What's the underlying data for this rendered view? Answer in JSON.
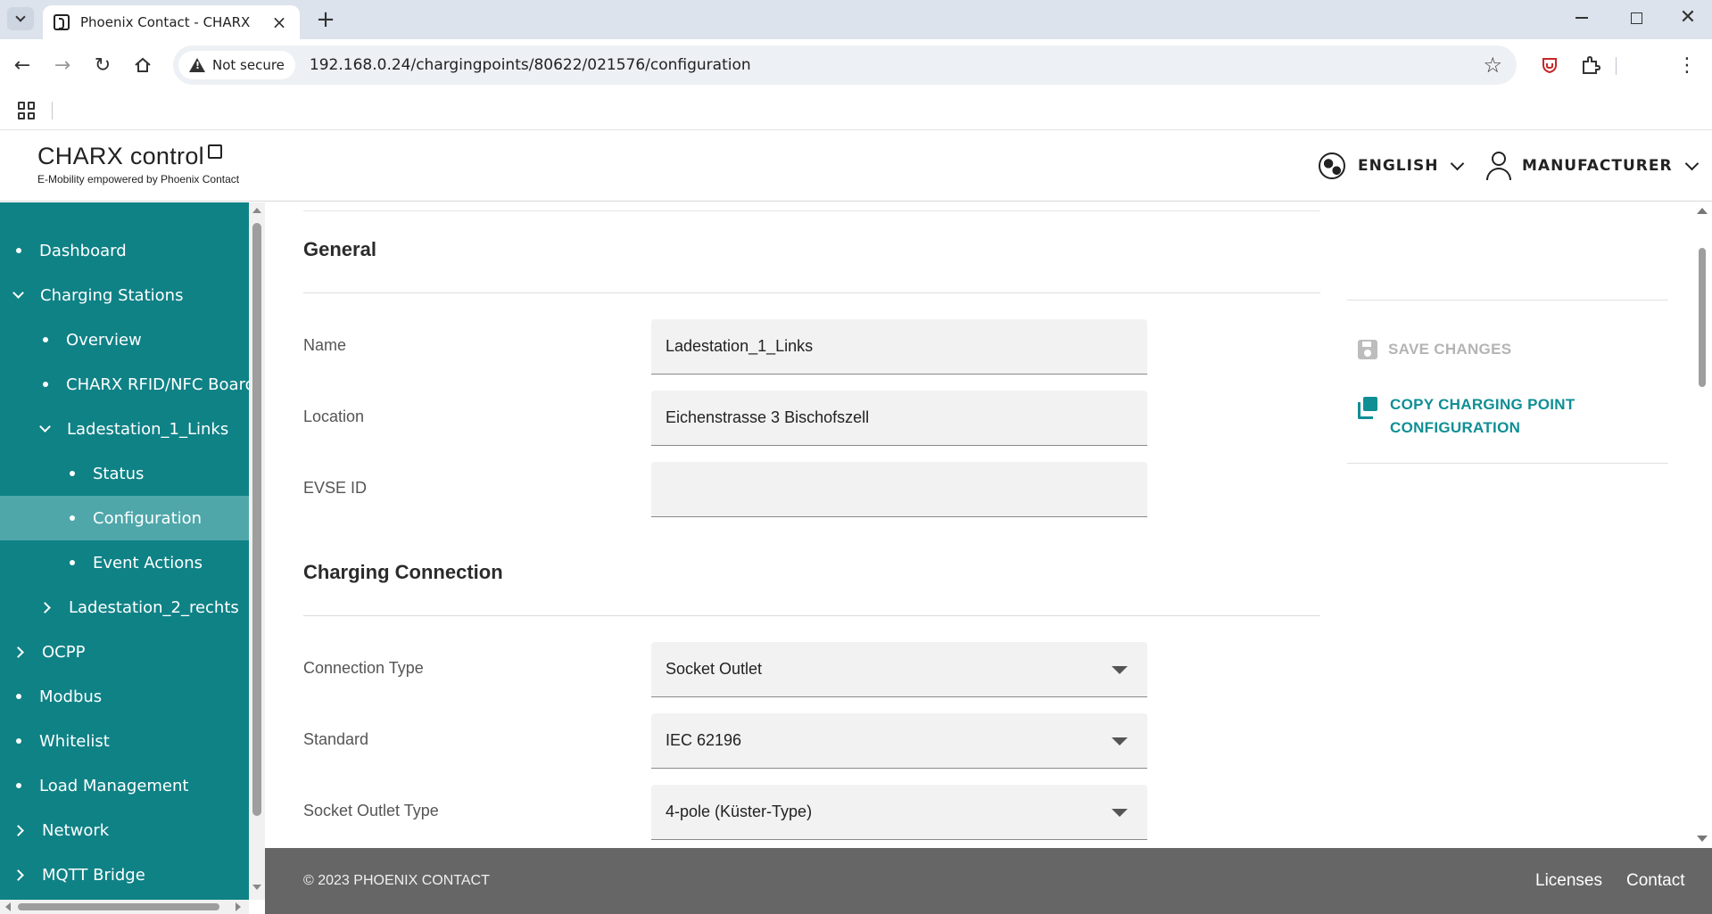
{
  "browser": {
    "tab_title": "Phoenix Contact - CHARX",
    "security_label": "Not secure",
    "url": "192.168.0.24/chargingpoints/80622/021576/configuration"
  },
  "header": {
    "logo_title": "CHARX control",
    "logo_subtitle": "E-Mobility empowered by Phoenix Contact",
    "language": "ENGLISH",
    "user": "MANUFACTURER"
  },
  "sidebar": {
    "items": [
      {
        "label": "Dashboard"
      },
      {
        "label": "Charging Stations"
      },
      {
        "label": "Overview"
      },
      {
        "label": "CHARX RFID/NFC Board"
      },
      {
        "label": "Ladestation_1_Links"
      },
      {
        "label": "Status"
      },
      {
        "label": "Configuration"
      },
      {
        "label": "Event Actions"
      },
      {
        "label": "Ladestation_2_rechts"
      },
      {
        "label": "OCPP"
      },
      {
        "label": "Modbus"
      },
      {
        "label": "Whitelist"
      },
      {
        "label": "Load Management"
      },
      {
        "label": "Network"
      },
      {
        "label": "MQTT Bridge"
      }
    ]
  },
  "general": {
    "title": "General",
    "name_label": "Name",
    "name_value": "Ladestation_1_Links",
    "location_label": "Location",
    "location_value": "Eichenstrasse 3 Bischofszell",
    "evse_label": "EVSE ID",
    "evse_value": ""
  },
  "connection": {
    "title": "Charging Connection",
    "type_label": "Connection Type",
    "type_value": "Socket Outlet",
    "standard_label": "Standard",
    "standard_value": "IEC 62196",
    "socket_label": "Socket Outlet Type",
    "socket_value": "4-pole (Küster-Type)"
  },
  "actions": {
    "save_label": "SAVE CHANGES",
    "copy_label_line1": "COPY CHARGING POINT",
    "copy_label_line2": "CONFIGURATION"
  },
  "footer": {
    "copyright": "© 2023 PHOENIX CONTACT",
    "licenses": "Licenses",
    "contact": "Contact"
  },
  "colors": {
    "sidebar_bg": "#0f8286",
    "sidebar_active": "#4fa7aa",
    "accent": "#0f8f94",
    "footer_bg": "#666666"
  }
}
